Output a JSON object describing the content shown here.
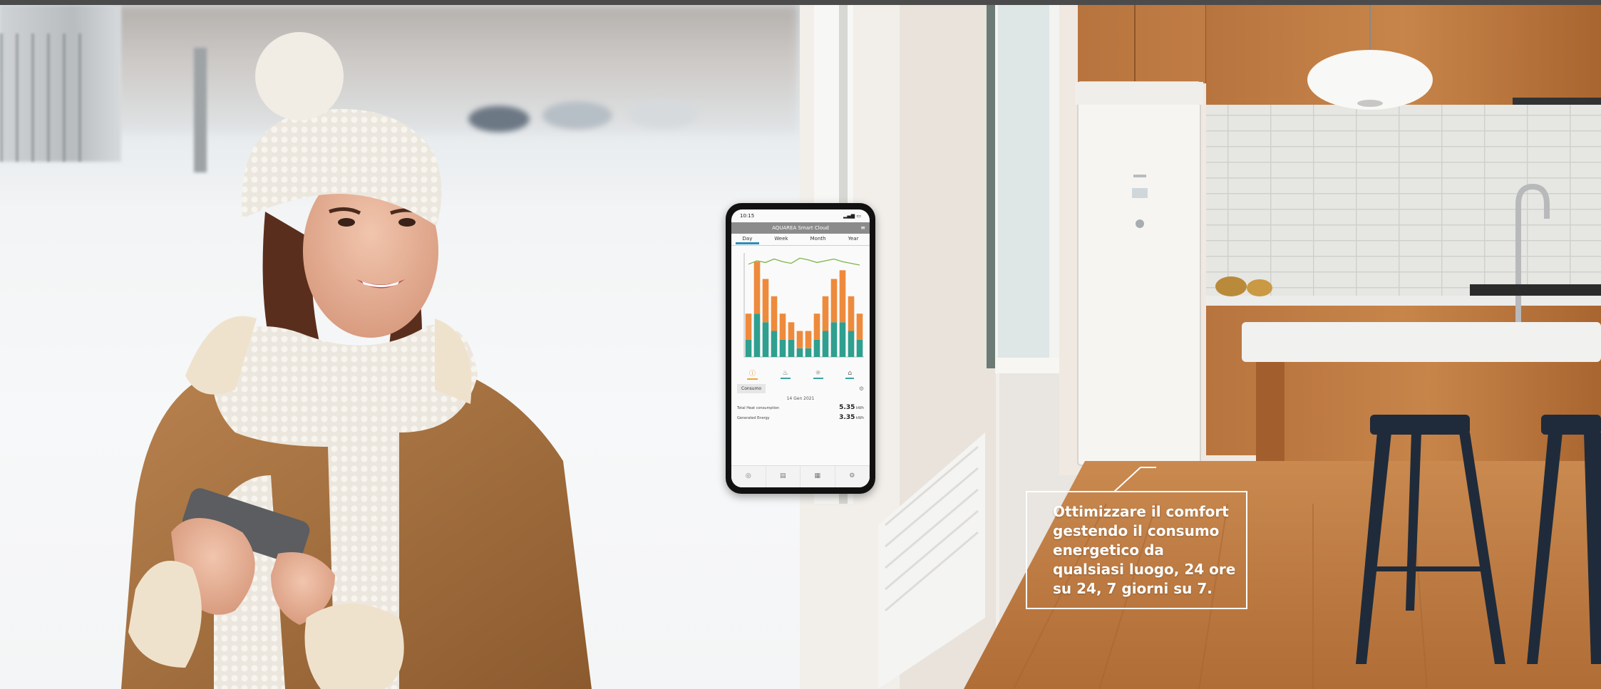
{
  "caption": {
    "text": "Ottimizzare il comfort gestendo il consumo energetico da qualsiasi luogo, 24 ore su 24, 7 giorni su 7."
  },
  "phone": {
    "status_time": "10:15",
    "app_title": "AQUAREA Smart Cloud",
    "tabs": [
      "Day",
      "Week",
      "Month",
      "Year"
    ],
    "consume_label": "Consumo",
    "date_label": "14 Gen 2021",
    "stats": [
      {
        "label": "Total Heat consumption",
        "value": "5.35",
        "unit": "kWh"
      },
      {
        "label": "Generated Energy",
        "value": "3.35",
        "unit": "kWh"
      }
    ],
    "colors": {
      "orange": "#ee8a3c",
      "teal": "#2f9f8f",
      "green": "#7ab648",
      "accent": "#2a8fb6"
    }
  },
  "chart_data": {
    "type": "bar",
    "stacked": true,
    "series": [
      {
        "values": [
          2,
          5,
          4,
          3,
          2,
          2,
          1,
          1,
          2,
          3,
          4,
          4,
          3,
          2
        ]
      },
      {
        "values": [
          3,
          6,
          5,
          4,
          3,
          2,
          2,
          2,
          3,
          4,
          5,
          6,
          4,
          3
        ]
      }
    ],
    "line_values": [
      6.2,
      6.6,
      6.4,
      6.8,
      6.5,
      6.3,
      6.9,
      6.7,
      6.4,
      6.6,
      6.8,
      6.5,
      6.3,
      6.1
    ],
    "colors": [
      "#2f9f8f",
      "#ee8a3c",
      "#7ab648"
    ]
  }
}
